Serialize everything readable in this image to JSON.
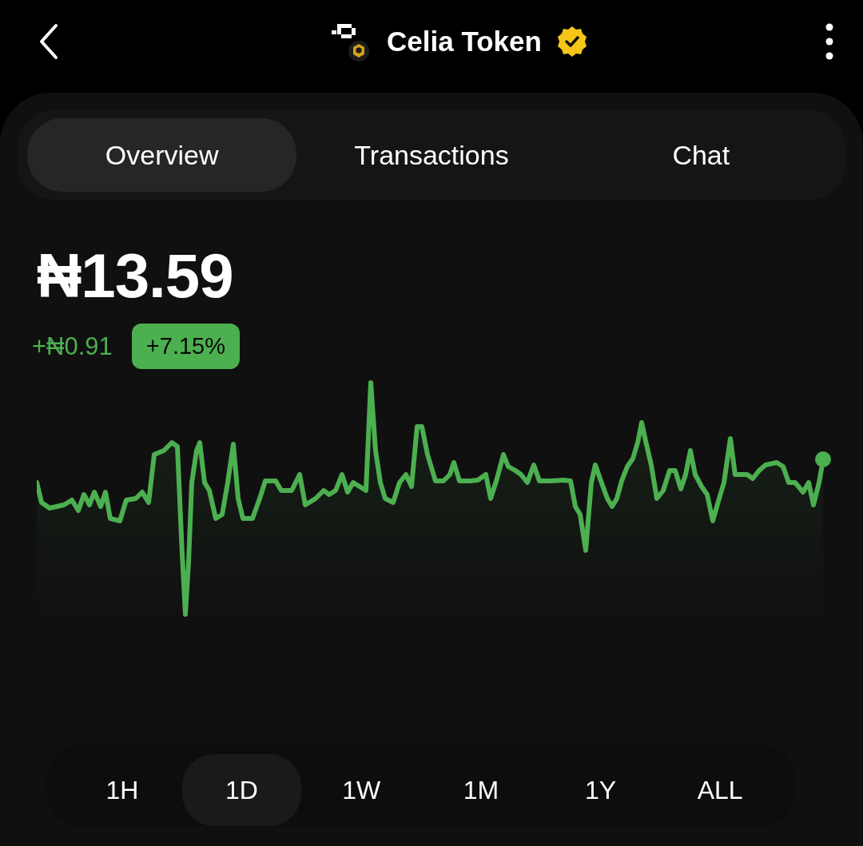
{
  "header": {
    "title": "Celia Token",
    "verified": true
  },
  "tabs": [
    {
      "label": "Overview",
      "selected": true
    },
    {
      "label": "Transactions",
      "selected": false
    },
    {
      "label": "Chat",
      "selected": false
    }
  ],
  "price": "₦13.59",
  "change": {
    "amount": "+₦0.91",
    "percent": "+7.15%"
  },
  "periods": [
    {
      "label": "1H",
      "selected": false
    },
    {
      "label": "1D",
      "selected": true
    },
    {
      "label": "1W",
      "selected": false
    },
    {
      "label": "1M",
      "selected": false
    },
    {
      "label": "1Y",
      "selected": false
    },
    {
      "label": "ALL",
      "selected": false
    }
  ]
}
